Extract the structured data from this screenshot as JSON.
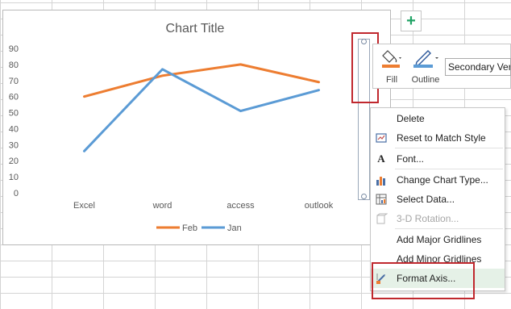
{
  "chart": {
    "title": "Chart Title",
    "axis_selected": "secondary-vertical"
  },
  "chart_data": {
    "type": "line",
    "title": "Chart Title",
    "categories": [
      "Excel",
      "word",
      "access",
      "outlook"
    ],
    "series": [
      {
        "name": "Feb",
        "values": [
          60,
          73,
          80,
          69
        ],
        "color": "#ed7d31"
      },
      {
        "name": "Jan",
        "values": [
          26,
          77,
          51,
          64
        ],
        "color": "#5b9bd5"
      }
    ],
    "ylim": [
      0,
      90
    ],
    "yticks": [
      "0",
      "10",
      "20",
      "30",
      "40",
      "50",
      "60",
      "70",
      "80",
      "90"
    ],
    "grid": false,
    "legend": "bottom"
  },
  "legend": {
    "items": [
      {
        "label": "Feb",
        "color": "#ed7d31"
      },
      {
        "label": "Jan",
        "color": "#5b9bd5"
      }
    ]
  },
  "side_buttons": {
    "add_element_icon": "plus-icon"
  },
  "mini_toolbar": {
    "fill_label": "Fill",
    "outline_label": "Outline",
    "selection_value": "Secondary Vert"
  },
  "context_menu": {
    "items": [
      {
        "label": "Delete",
        "icon": "",
        "enabled": true
      },
      {
        "label": "Reset to Match Style",
        "icon": "reset-style-icon",
        "enabled": true
      },
      {
        "label": "Font...",
        "icon": "font-icon",
        "enabled": true
      },
      {
        "label": "Change Chart Type...",
        "icon": "change-chart-type-icon",
        "enabled": true
      },
      {
        "label": "Select Data...",
        "icon": "select-data-icon",
        "enabled": true
      },
      {
        "label": "3-D Rotation...",
        "icon": "rotation-icon",
        "enabled": false
      },
      {
        "label": "Add Major Gridlines",
        "icon": "",
        "enabled": true
      },
      {
        "label": "Add Minor Gridlines",
        "icon": "",
        "enabled": true
      },
      {
        "label": "Format Axis...",
        "icon": "format-axis-icon",
        "enabled": true
      }
    ]
  },
  "colors": {
    "accent_highlight": "#c0282e",
    "hover": "#e5f1e7",
    "excel_green": "#21a366"
  }
}
